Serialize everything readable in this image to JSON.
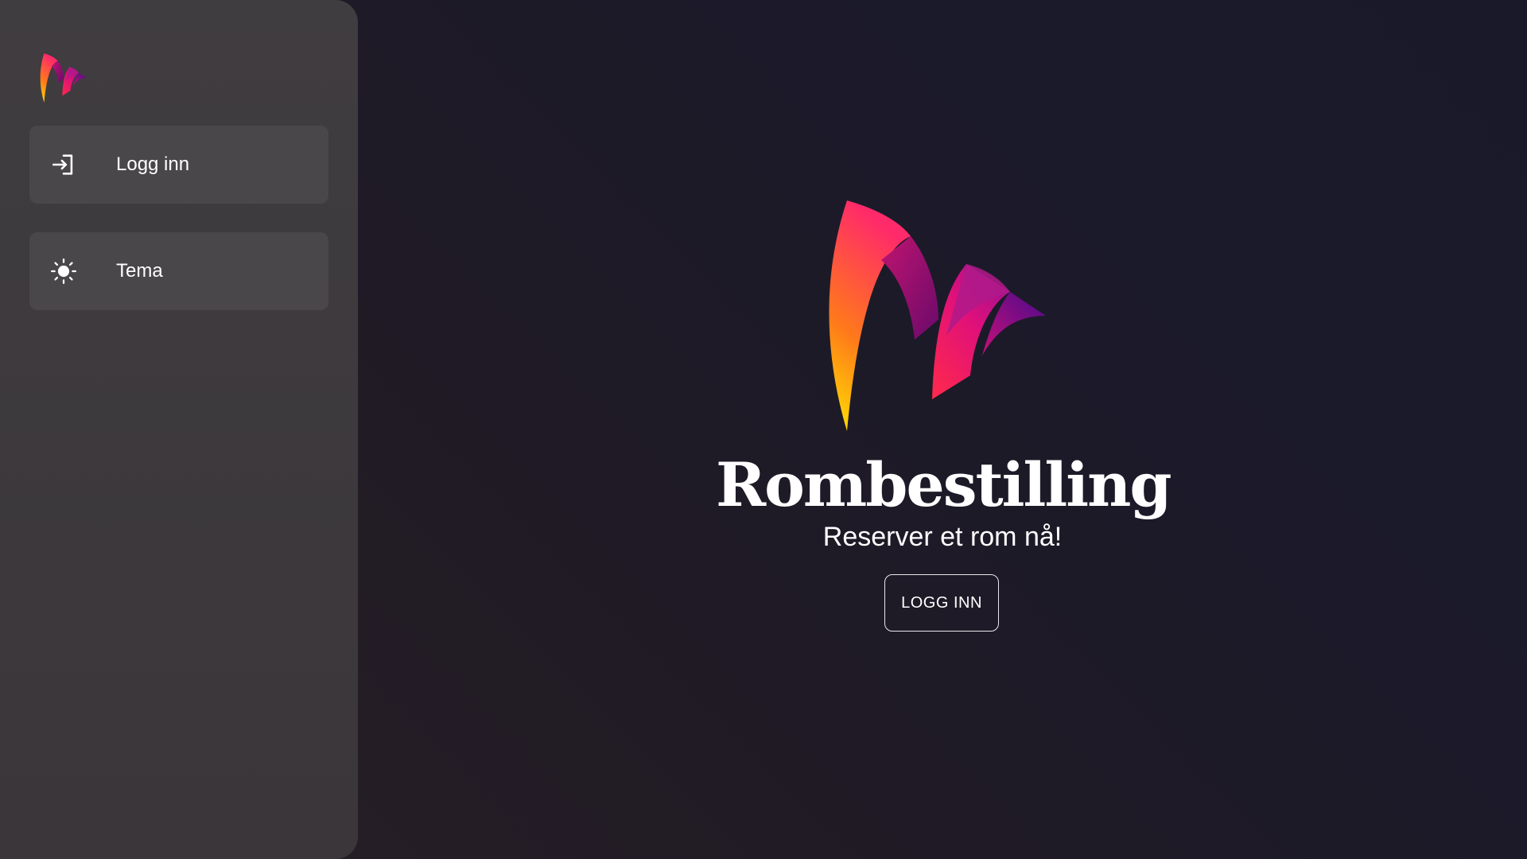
{
  "sidebar": {
    "logo_icon": "brand-logo-icon",
    "items": [
      {
        "label": "Logg inn",
        "icon": "login-icon"
      },
      {
        "label": "Tema",
        "icon": "sun-icon"
      }
    ]
  },
  "hero": {
    "logo_icon": "brand-logo-icon",
    "title": "Rombestilling",
    "subtitle": "Reserver et rom nå!",
    "login_button_label": "LOGG INN"
  },
  "colors": {
    "background": "#1c1a28",
    "sidebar": "#3d3a3e",
    "nav_item": "#4a474b",
    "text": "#ffffff",
    "logo_gradient": [
      "#ffe600",
      "#ff7a1a",
      "#ff1f6a",
      "#b0007a",
      "#5a0a8a"
    ]
  }
}
